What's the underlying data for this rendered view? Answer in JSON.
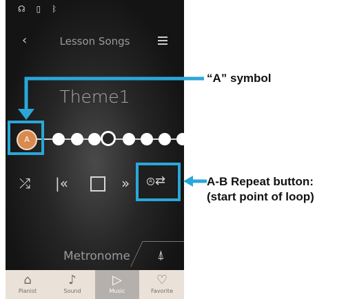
{
  "header": {
    "title": "Lesson Songs"
  },
  "song": {
    "title": "Theme1"
  },
  "metronome": {
    "label": "Metronome"
  },
  "marker": {
    "label": "A"
  },
  "ab_button": {
    "badge": "A"
  },
  "tabs": [
    {
      "label": "Pianist",
      "icon": "piano-icon"
    },
    {
      "label": "Sound",
      "icon": "music-note-icon"
    },
    {
      "label": "Music",
      "icon": "play-icon",
      "active": true
    },
    {
      "label": "Favorite",
      "icon": "heart-icon"
    }
  ],
  "annotations": {
    "a_symbol": "“A” symbol",
    "ab_line1": "A-B Repeat button:",
    "ab_line2": "(start point of loop)"
  },
  "colors": {
    "highlight": "#2aa7d8",
    "marker": "#d98a4e"
  }
}
